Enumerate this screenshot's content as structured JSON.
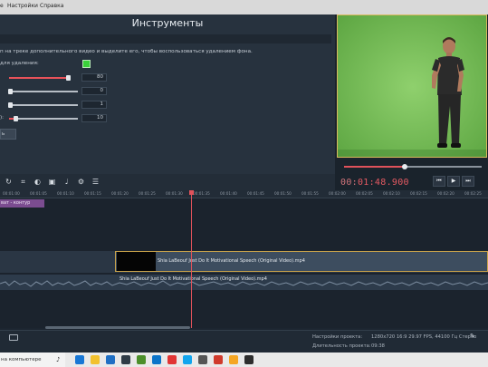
{
  "menu": {
    "items": [
      "е",
      "Настройки",
      "Справка"
    ]
  },
  "tools": {
    "title": "Инструменты",
    "description": "п на треке дополнительного видео и выделите его, чтобы воспользоваться удалением фона.",
    "color_label": "для удаления:",
    "key_color": "#3bd23b",
    "sliders": [
      {
        "label": "",
        "value": "80",
        "fraction": 0.95
      },
      {
        "label": "",
        "value": "0",
        "fraction": 0.0
      },
      {
        "label": "",
        "value": "1",
        "fraction": 0.01
      },
      {
        "label": "):",
        "value": "10",
        "fraction": 0.1
      }
    ],
    "apply_label": "ь"
  },
  "preview": {
    "timecode_dim": "00:",
    "timecode_main": "01:48.900",
    "seek_fraction": 0.44,
    "transport": [
      "⏮",
      "▶",
      "⏭"
    ]
  },
  "ruler": {
    "ticks": [
      "00:01:00",
      "00:01:05",
      "00:01:10",
      "00:01:15",
      "00:01:20",
      "00:01:25",
      "00:01:30",
      "00:01:35",
      "00:01:40",
      "00:01:45",
      "00:01:50",
      "00:01:55",
      "00:02:00",
      "00:02:05",
      "00:02:10",
      "00:02:15",
      "00:02:20",
      "00:02:25"
    ]
  },
  "timeline": {
    "text_clip": "ват - контур",
    "video_clip": "Shia LaBeouf Just Do It Motivational Speech (Original Video).mp4",
    "audio_clip": "Shia LaBeouf Just Do It Motivational Speech (Original Video).mp4"
  },
  "status": {
    "settings_label": "Настройки проекта:",
    "settings_value": "1280x720 16:9 29.97 FPS, 44100 Гц Стерео",
    "duration_label": "Длительность проекта:",
    "duration_value": "09:38"
  },
  "taskbar": {
    "search_placeholder": "на компьютере",
    "apps": [
      "#1877d5",
      "#f2c12e",
      "#1f6fc4",
      "#2f3b46",
      "#4b8f2a",
      "#0b74c9",
      "#e13535",
      "#11a5ee",
      "#555555",
      "#d03a2c",
      "#f5a623",
      "#2d2d2d"
    ]
  }
}
